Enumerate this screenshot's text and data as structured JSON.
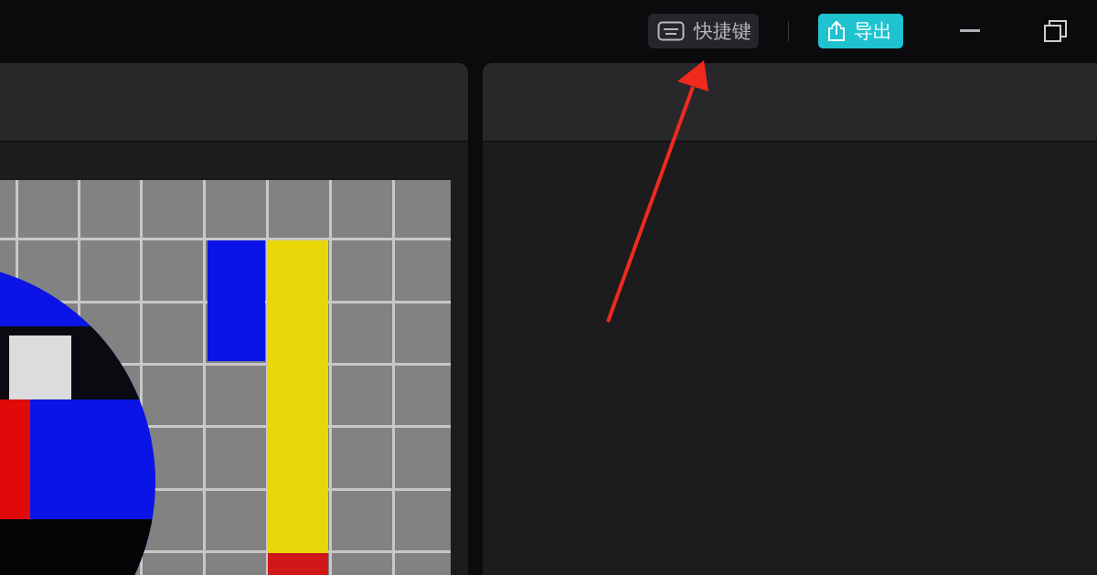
{
  "toolbar": {
    "shortcuts_button": {
      "label": "快捷键"
    },
    "export_button": {
      "label": "导出"
    }
  }
}
